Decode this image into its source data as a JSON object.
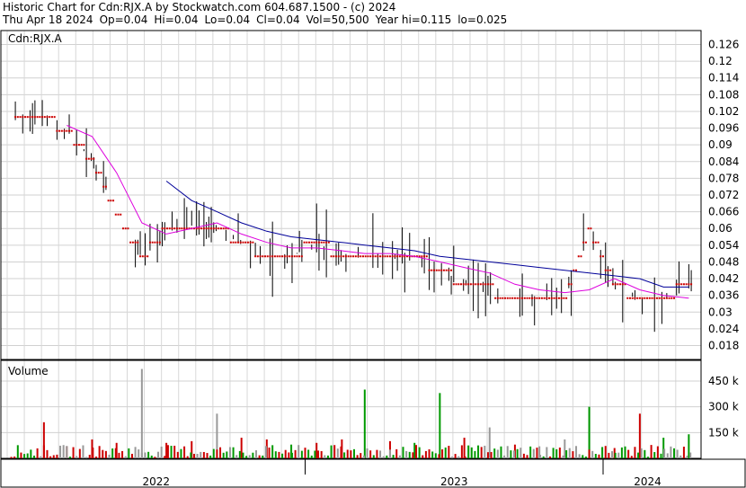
{
  "header": {
    "title": "Historic Chart for Cdn:RJX.A by Stockwatch.com 604.687.1500 - (c) 2024",
    "date": "Thu Apr 18 2024",
    "open": "Op=0.04",
    "high": "Hi=0.04",
    "low": "Lo=0.04",
    "close": "Cl=0.04",
    "volume": "Vol=50,500",
    "year_high": "Year hi=0.115",
    "year_low": "lo=0.025"
  },
  "chart_data": [
    {
      "type": "line",
      "title": "Cdn:RJX.A",
      "ylim": [
        0.013,
        0.131
      ],
      "y_ticks": [
        0.126,
        0.12,
        0.114,
        0.108,
        0.102,
        0.096,
        0.09,
        0.084,
        0.078,
        0.072,
        0.066,
        0.06,
        0.054,
        0.048,
        0.042,
        0.036,
        0.03,
        0.024,
        0.018
      ],
      "grid": true,
      "x": [
        "2022-02",
        "2022-03",
        "2022-04",
        "2022-05",
        "2022-06",
        "2022-07",
        "2022-08",
        "2022-09",
        "2022-10",
        "2022-11",
        "2022-12",
        "2023-01",
        "2023-02",
        "2023-03",
        "2023-04",
        "2023-05",
        "2023-06",
        "2023-07",
        "2023-08",
        "2023-09",
        "2023-10",
        "2023-11",
        "2023-12",
        "2024-01",
        "2024-02",
        "2024-03",
        "2024-04"
      ],
      "series": [
        {
          "role": "close",
          "color": "#cc0000",
          "values": [
            0.1,
            0.095,
            0.085,
            0.066,
            0.05,
            0.06,
            0.062,
            0.06,
            0.055,
            0.05,
            0.05,
            0.055,
            0.05,
            0.05,
            0.05,
            0.05,
            0.045,
            0.04,
            0.038,
            0.035,
            0.035,
            0.035,
            0.06,
            0.04,
            0.035,
            0.035,
            0.04
          ]
        },
        {
          "role": "short moving average",
          "color": "#dd00dd",
          "values": [
            null,
            0.097,
            0.093,
            0.08,
            0.062,
            0.058,
            0.06,
            0.062,
            0.058,
            0.055,
            0.053,
            0.053,
            0.052,
            0.051,
            0.051,
            0.05,
            0.048,
            0.046,
            0.044,
            0.04,
            0.038,
            0.037,
            0.038,
            0.042,
            0.038,
            0.036,
            0.035
          ]
        },
        {
          "role": "long moving average",
          "color": "#000099",
          "values": [
            null,
            null,
            null,
            null,
            null,
            0.077,
            0.07,
            0.066,
            0.062,
            0.059,
            0.057,
            0.056,
            0.055,
            0.054,
            0.053,
            0.052,
            0.05,
            0.049,
            0.048,
            0.047,
            0.046,
            0.045,
            0.044,
            0.043,
            0.042,
            0.039,
            0.039
          ]
        }
      ]
    },
    {
      "type": "bar",
      "title": "Volume",
      "y_ticks": [
        "450 k",
        "300 k",
        "150 k"
      ],
      "ylim": [
        0,
        570000
      ],
      "colors": {
        "up": "#009900",
        "down": "#cc0000",
        "flat": "#999999"
      },
      "x": [
        "2022-02",
        "2022-03",
        "2022-04",
        "2022-05",
        "2022-06",
        "2022-07",
        "2022-08",
        "2022-09",
        "2022-10",
        "2022-11",
        "2022-12",
        "2023-01",
        "2023-02",
        "2023-03",
        "2023-04",
        "2023-05",
        "2023-06",
        "2023-07",
        "2023-08",
        "2023-09",
        "2023-10",
        "2023-11",
        "2023-12",
        "2024-01",
        "2024-02",
        "2024-03",
        "2024-04"
      ],
      "values": [
        210000,
        70000,
        110000,
        90000,
        520000,
        90000,
        100000,
        260000,
        120000,
        110000,
        80000,
        90000,
        110000,
        400000,
        100000,
        90000,
        380000,
        120000,
        180000,
        80000,
        70000,
        110000,
        300000,
        60000,
        260000,
        120000,
        140000
      ],
      "directions": [
        "down",
        "down",
        "down",
        "down",
        "flat",
        "down",
        "down",
        "flat",
        "down",
        "down",
        "up",
        "down",
        "down",
        "up",
        "down",
        "up",
        "up",
        "down",
        "flat",
        "down",
        "flat",
        "flat",
        "up",
        "down",
        "down",
        "up",
        "up"
      ]
    }
  ],
  "x_axis": {
    "years": [
      "2022",
      "2023",
      "2024"
    ]
  }
}
